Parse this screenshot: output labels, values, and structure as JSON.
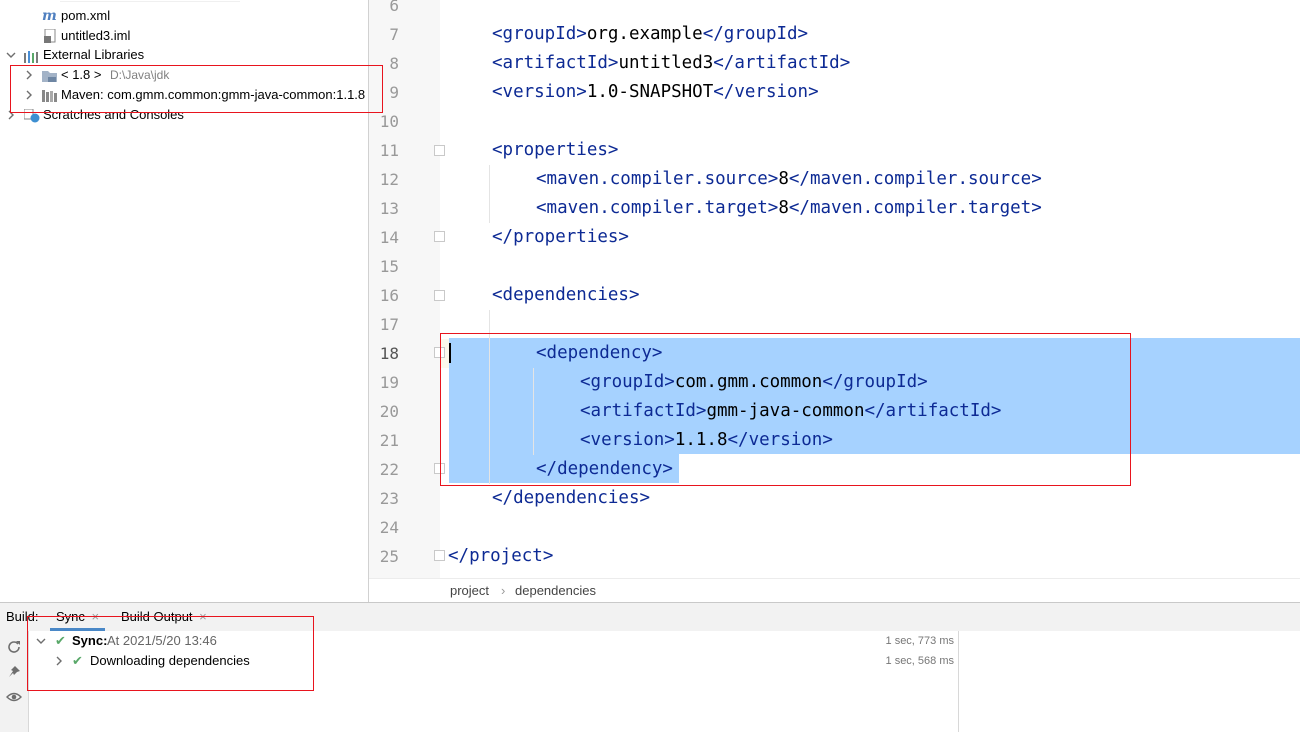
{
  "project_tree": {
    "pom_file": "pom.xml",
    "iml_file": "untitled3.iml",
    "external_libraries": "External Libraries",
    "jdk_name": "< 1.8 >",
    "jdk_path": "D:\\Java\\jdk",
    "maven_lib": "Maven: com.gmm.common:gmm-java-common:1.1.8",
    "scratches": "Scratches and Consoles"
  },
  "editor": {
    "line_numbers": [
      "6",
      "7",
      "8",
      "9",
      "10",
      "11",
      "12",
      "13",
      "14",
      "15",
      "16",
      "17",
      "18",
      "19",
      "20",
      "21",
      "22",
      "23",
      "24",
      "25"
    ],
    "lines": {
      "l7": {
        "open": "<groupId>",
        "text": "org.example",
        "close": "</groupId>"
      },
      "l8": {
        "open": "<artifactId>",
        "text": "untitled3",
        "close": "</artifactId>"
      },
      "l9": {
        "open": "<version>",
        "text": "1.0-SNAPSHOT",
        "close": "</version>"
      },
      "l11": {
        "open": "<properties>"
      },
      "l12": {
        "open": "<maven.compiler.source>",
        "text": "8",
        "close": "</maven.compiler.source>"
      },
      "l13": {
        "open": "<maven.compiler.target>",
        "text": "8",
        "close": "</maven.compiler.target>"
      },
      "l14": {
        "close": "</properties>"
      },
      "l16": {
        "open": "<dependencies>"
      },
      "l18": {
        "open": "<dependency>"
      },
      "l19": {
        "open": "<groupId>",
        "text": "com.gmm.common",
        "close": "</groupId>"
      },
      "l20": {
        "open": "<artifactId>",
        "text": "gmm-java-common",
        "close": "</artifactId>"
      },
      "l21": {
        "open": "<version>",
        "text": "1.1.8",
        "close": "</version>"
      },
      "l22": {
        "close": "</dependency>"
      },
      "l23": {
        "close": "</dependencies>"
      },
      "l25": {
        "close": "</project>"
      }
    },
    "colors": {
      "tag": "#0d2a94",
      "selection": "#a6d2ff",
      "highlight_box": "#e8141e"
    }
  },
  "breadcrumb": {
    "item1": "project",
    "sep": "›",
    "item2": "dependencies"
  },
  "build_window": {
    "tab_build": "Build:",
    "tab_sync": "Sync",
    "tab_output": "Build Output",
    "close_glyph": "×",
    "sync_label": "Sync:",
    "sync_time": "At 2021/5/20 13:46",
    "sync_duration": "1 sec, 773 ms",
    "download_label": "Downloading dependencies",
    "download_duration": "1 sec, 568 ms"
  }
}
